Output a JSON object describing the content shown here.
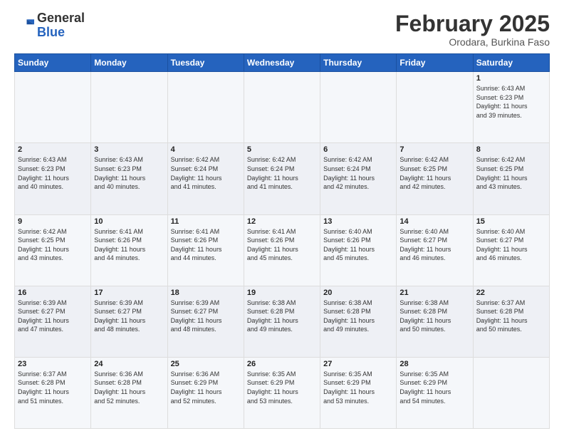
{
  "header": {
    "logo_general": "General",
    "logo_blue": "Blue",
    "month_title": "February 2025",
    "location": "Orodara, Burkina Faso"
  },
  "weekdays": [
    "Sunday",
    "Monday",
    "Tuesday",
    "Wednesday",
    "Thursday",
    "Friday",
    "Saturday"
  ],
  "weeks": [
    [
      {
        "day": "",
        "info": ""
      },
      {
        "day": "",
        "info": ""
      },
      {
        "day": "",
        "info": ""
      },
      {
        "day": "",
        "info": ""
      },
      {
        "day": "",
        "info": ""
      },
      {
        "day": "",
        "info": ""
      },
      {
        "day": "1",
        "info": "Sunrise: 6:43 AM\nSunset: 6:23 PM\nDaylight: 11 hours\nand 39 minutes."
      }
    ],
    [
      {
        "day": "2",
        "info": "Sunrise: 6:43 AM\nSunset: 6:23 PM\nDaylight: 11 hours\nand 40 minutes."
      },
      {
        "day": "3",
        "info": "Sunrise: 6:43 AM\nSunset: 6:23 PM\nDaylight: 11 hours\nand 40 minutes."
      },
      {
        "day": "4",
        "info": "Sunrise: 6:42 AM\nSunset: 6:24 PM\nDaylight: 11 hours\nand 41 minutes."
      },
      {
        "day": "5",
        "info": "Sunrise: 6:42 AM\nSunset: 6:24 PM\nDaylight: 11 hours\nand 41 minutes."
      },
      {
        "day": "6",
        "info": "Sunrise: 6:42 AM\nSunset: 6:24 PM\nDaylight: 11 hours\nand 42 minutes."
      },
      {
        "day": "7",
        "info": "Sunrise: 6:42 AM\nSunset: 6:25 PM\nDaylight: 11 hours\nand 42 minutes."
      },
      {
        "day": "8",
        "info": "Sunrise: 6:42 AM\nSunset: 6:25 PM\nDaylight: 11 hours\nand 43 minutes."
      }
    ],
    [
      {
        "day": "9",
        "info": "Sunrise: 6:42 AM\nSunset: 6:25 PM\nDaylight: 11 hours\nand 43 minutes."
      },
      {
        "day": "10",
        "info": "Sunrise: 6:41 AM\nSunset: 6:26 PM\nDaylight: 11 hours\nand 44 minutes."
      },
      {
        "day": "11",
        "info": "Sunrise: 6:41 AM\nSunset: 6:26 PM\nDaylight: 11 hours\nand 44 minutes."
      },
      {
        "day": "12",
        "info": "Sunrise: 6:41 AM\nSunset: 6:26 PM\nDaylight: 11 hours\nand 45 minutes."
      },
      {
        "day": "13",
        "info": "Sunrise: 6:40 AM\nSunset: 6:26 PM\nDaylight: 11 hours\nand 45 minutes."
      },
      {
        "day": "14",
        "info": "Sunrise: 6:40 AM\nSunset: 6:27 PM\nDaylight: 11 hours\nand 46 minutes."
      },
      {
        "day": "15",
        "info": "Sunrise: 6:40 AM\nSunset: 6:27 PM\nDaylight: 11 hours\nand 46 minutes."
      }
    ],
    [
      {
        "day": "16",
        "info": "Sunrise: 6:39 AM\nSunset: 6:27 PM\nDaylight: 11 hours\nand 47 minutes."
      },
      {
        "day": "17",
        "info": "Sunrise: 6:39 AM\nSunset: 6:27 PM\nDaylight: 11 hours\nand 48 minutes."
      },
      {
        "day": "18",
        "info": "Sunrise: 6:39 AM\nSunset: 6:27 PM\nDaylight: 11 hours\nand 48 minutes."
      },
      {
        "day": "19",
        "info": "Sunrise: 6:38 AM\nSunset: 6:28 PM\nDaylight: 11 hours\nand 49 minutes."
      },
      {
        "day": "20",
        "info": "Sunrise: 6:38 AM\nSunset: 6:28 PM\nDaylight: 11 hours\nand 49 minutes."
      },
      {
        "day": "21",
        "info": "Sunrise: 6:38 AM\nSunset: 6:28 PM\nDaylight: 11 hours\nand 50 minutes."
      },
      {
        "day": "22",
        "info": "Sunrise: 6:37 AM\nSunset: 6:28 PM\nDaylight: 11 hours\nand 50 minutes."
      }
    ],
    [
      {
        "day": "23",
        "info": "Sunrise: 6:37 AM\nSunset: 6:28 PM\nDaylight: 11 hours\nand 51 minutes."
      },
      {
        "day": "24",
        "info": "Sunrise: 6:36 AM\nSunset: 6:28 PM\nDaylight: 11 hours\nand 52 minutes."
      },
      {
        "day": "25",
        "info": "Sunrise: 6:36 AM\nSunset: 6:29 PM\nDaylight: 11 hours\nand 52 minutes."
      },
      {
        "day": "26",
        "info": "Sunrise: 6:35 AM\nSunset: 6:29 PM\nDaylight: 11 hours\nand 53 minutes."
      },
      {
        "day": "27",
        "info": "Sunrise: 6:35 AM\nSunset: 6:29 PM\nDaylight: 11 hours\nand 53 minutes."
      },
      {
        "day": "28",
        "info": "Sunrise: 6:35 AM\nSunset: 6:29 PM\nDaylight: 11 hours\nand 54 minutes."
      },
      {
        "day": "",
        "info": ""
      }
    ]
  ]
}
